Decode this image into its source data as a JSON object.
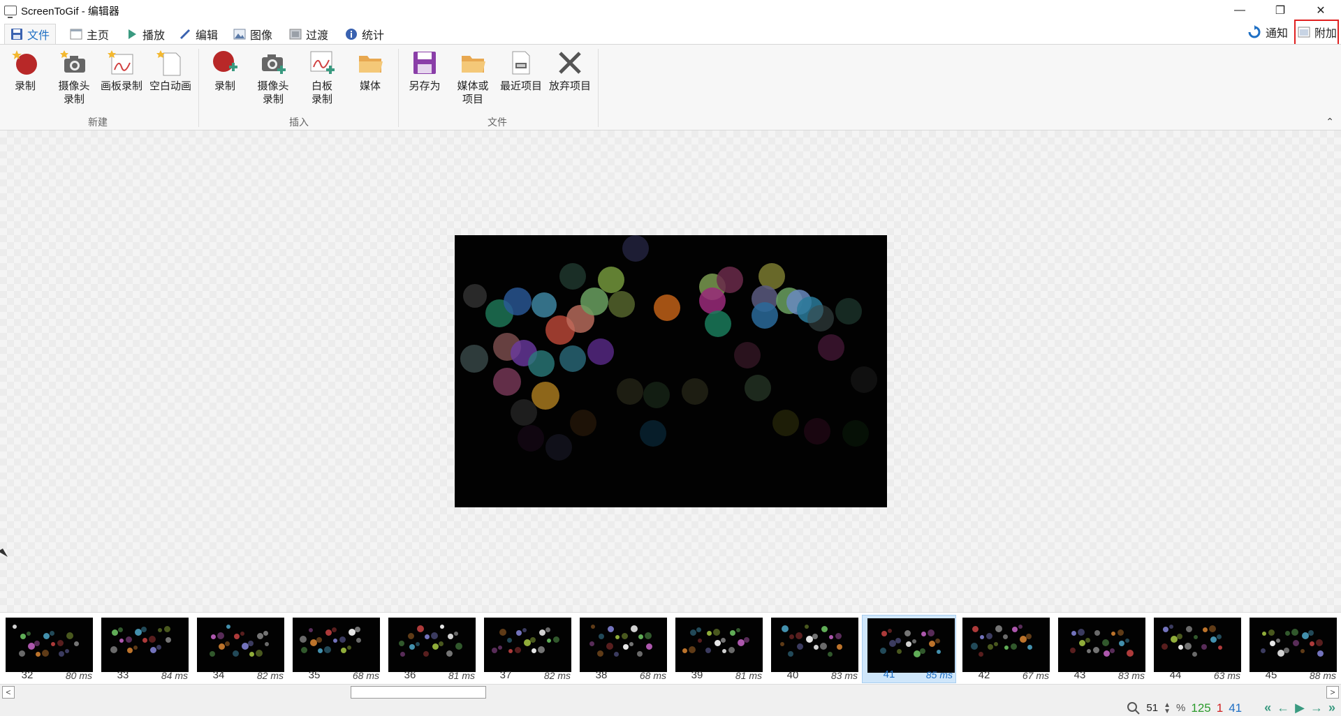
{
  "window": {
    "title": "ScreenToGif - 编辑器",
    "minimize_glyph": "—",
    "restore_glyph": "❐",
    "close_glyph": "✕"
  },
  "tabs": [
    {
      "label": "文件",
      "icon": "floppy-icon",
      "active": true
    },
    {
      "label": "主页",
      "icon": "home-window-icon",
      "active": false
    },
    {
      "label": "播放",
      "icon": "play-icon",
      "active": false
    },
    {
      "label": "编辑",
      "icon": "pencil-icon",
      "active": false
    },
    {
      "label": "图像",
      "icon": "image-icon",
      "active": false
    },
    {
      "label": "过渡",
      "icon": "transition-icon",
      "active": false
    },
    {
      "label": "统计",
      "icon": "info-icon",
      "active": false
    }
  ],
  "right_tabs": {
    "notify_label": "通知",
    "extra_label": "附加"
  },
  "ribbon": {
    "groups": {
      "new_label": "新建",
      "insert_label": "插入",
      "file_label": "文件"
    },
    "buttons": {
      "record": "录制",
      "webcam_record": "摄像头\n录制",
      "board_record": "画板录制",
      "blank_animation": "空白动画",
      "insert_record": "录制",
      "insert_webcam_record": "摄像头\n录制",
      "insert_board_record": "白板\n录制",
      "insert_media": "媒体",
      "save_as": "另存为",
      "media_or_project": "媒体或\n项目",
      "recent_projects": "最近项目",
      "discard_project": "放弃项目"
    },
    "collapse_glyph": "⌃"
  },
  "frames": [
    {
      "number": "32",
      "duration": "80 ms",
      "selected": false
    },
    {
      "number": "33",
      "duration": "84 ms",
      "selected": false
    },
    {
      "number": "34",
      "duration": "82 ms",
      "selected": false
    },
    {
      "number": "35",
      "duration": "68 ms",
      "selected": false
    },
    {
      "number": "36",
      "duration": "81 ms",
      "selected": false
    },
    {
      "number": "37",
      "duration": "82 ms",
      "selected": false
    },
    {
      "number": "38",
      "duration": "68 ms",
      "selected": false
    },
    {
      "number": "39",
      "duration": "81 ms",
      "selected": false
    },
    {
      "number": "40",
      "duration": "83 ms",
      "selected": false
    },
    {
      "number": "41",
      "duration": "85 ms",
      "selected": true
    },
    {
      "number": "42",
      "duration": "67 ms",
      "selected": false
    },
    {
      "number": "43",
      "duration": "83 ms",
      "selected": false
    },
    {
      "number": "44",
      "duration": "63 ms",
      "selected": false
    },
    {
      "number": "45",
      "duration": "88 ms",
      "selected": false
    }
  ],
  "scrollbar": {
    "left_glyph": "<",
    "right_glyph": ">"
  },
  "status": {
    "zoom": "51",
    "zoom_unit": "%",
    "frame_count": "125",
    "selected_count": "1",
    "current_frame": "41",
    "frame_count_color": "#2a9a2a",
    "selected_count_color": "#d02020",
    "current_frame_color": "#1e6fc4"
  }
}
